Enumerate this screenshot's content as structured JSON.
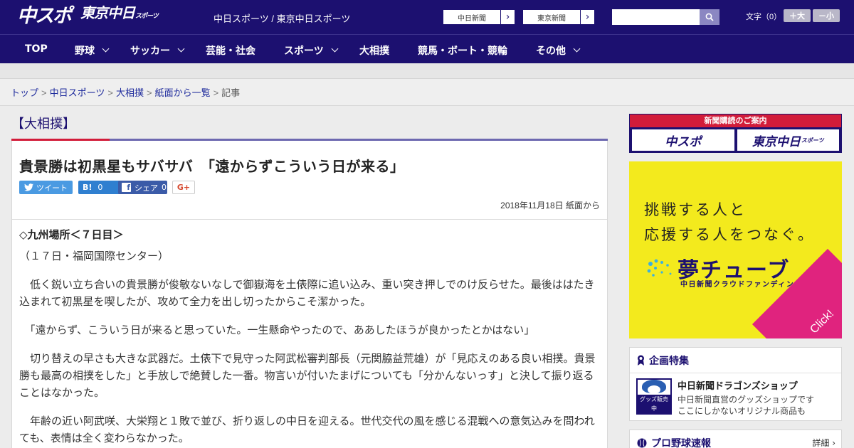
{
  "header": {
    "logo_chunichi_sports": "中スポ",
    "logo_tokyo_chunichi": "東京中日",
    "logo_tokyo_suffix": "スポーツ",
    "site_name": "中日スポーツ / 東京中日スポーツ",
    "paper_links": [
      {
        "label": "中日新聞"
      },
      {
        "label": "東京新聞"
      }
    ],
    "search_placeholder": "",
    "font_size_label": "文字（0）",
    "font_larger": "＋大",
    "font_smaller": "－小"
  },
  "nav": {
    "items": [
      {
        "label": "TOP"
      },
      {
        "label": "野球"
      },
      {
        "label": "サッカー"
      },
      {
        "label": "芸能・社会"
      },
      {
        "label": "スポーツ"
      },
      {
        "label": "大相撲"
      },
      {
        "label": "競馬・ボート・競輪"
      },
      {
        "label": "その他"
      }
    ]
  },
  "breadcrumb": {
    "items": [
      "トップ",
      "中日スポーツ",
      "大相撲",
      "紙面から一覧"
    ],
    "current": "記事"
  },
  "article": {
    "category": "【大相撲】",
    "headline": "貴景勝は初黒星もサバサバ　「遠からずこういう日が来る」",
    "share": {
      "tweet": "ツイート",
      "hatena_count": "0",
      "facebook": "シェア",
      "facebook_count": "0",
      "gplus": "G+"
    },
    "date": "2018年11月18日 紙面から",
    "subheading": "◇九州場所＜７日目＞",
    "venue": "（１７日・福岡国際センター）",
    "paragraphs": [
      "　低く鋭い立ち合いの貴景勝が俊敏ないなしで御嶽海を土俵際に追い込み、重い突き押しでのけ反らせた。最後ははたき込まれて初黒星を喫したが、攻めて全力を出し切ったからこそ潔かった。",
      "　「遠からず、こういう日が来ると思っていた。一生懸命やったので、ああしたほうが良かったとかはない」",
      "　切り替えの早さも大きな武器だ。土俵下で見守った阿武松審判部長（元関脇益荒雄）が「見応えのある良い相撲。貴景勝も最高の相撲をした」と手放しで絶賛した一番。物言いが付いたまげについても「分かんないっす」と決して振り返ることはなかった。",
      "　年齢の近い阿武咲、大栄翔と１敗で並び、折り返しの中日を迎える。世代交代の風を感じる混戦への意気込みを問われても、表情は全く変わらなかった。"
    ]
  },
  "sidebar": {
    "subscribe_title": "新聞購読のご案内",
    "subscribe_logo1": "中スポ",
    "subscribe_logo2": "東京中日",
    "subscribe_logo2_suffix": "スポーツ",
    "ad": {
      "line1": "挑戦する人と",
      "line2": "応援する人をつなぐ。",
      "brand": "夢チューブ",
      "brand_sub": "中日新聞クラウドファンディング",
      "click": "Click!"
    },
    "feature": {
      "heading": "企画特集",
      "title": "中日新聞ドラゴンズショップ",
      "desc1": "中日新聞直営のグッズショップです",
      "desc2": "ここにしかないオリジナル商品も",
      "thumb_label": "グッズ販売中"
    },
    "baseball": {
      "heading": "プロ野球速報",
      "more": "詳細 ›"
    }
  },
  "colors": {
    "brand_navy": "#1c1070",
    "accent_red": "#d21c3a",
    "ad_yellow": "#f3ea1d",
    "ad_pink": "#e0237e",
    "twitter": "#4a9ae2",
    "hatena": "#2f7fd0",
    "facebook": "#3b5ba8"
  }
}
